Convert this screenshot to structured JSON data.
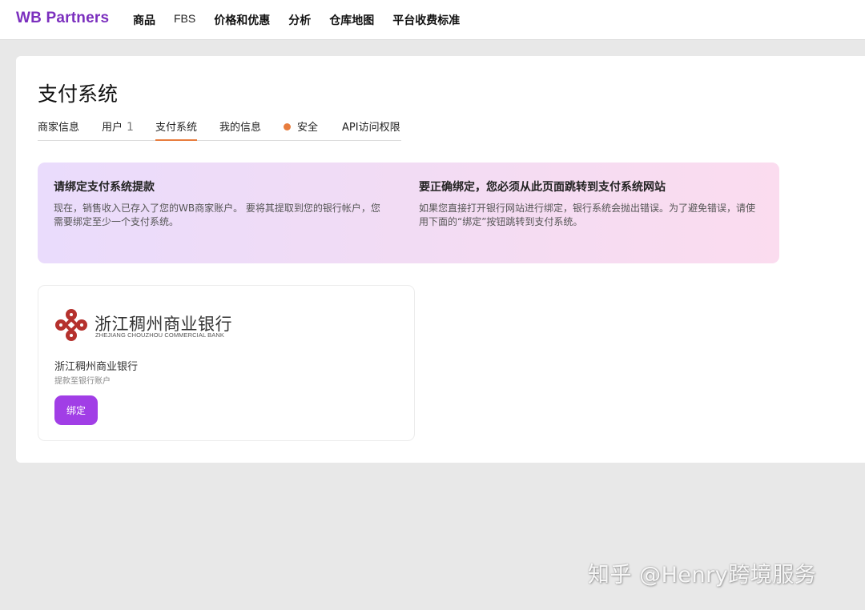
{
  "brand": "WB Partners",
  "nav": [
    "商品",
    "FBS",
    "价格和优惠",
    "分析",
    "仓库地图",
    "平台收费标准"
  ],
  "page_title": "支付系统",
  "tabs": {
    "merchant_info": "商家信息",
    "users": "用户",
    "users_count": "1",
    "payment": "支付系统",
    "my_info": "我的信息",
    "security": "安全",
    "api": "API访问权限"
  },
  "banner": {
    "left_title": "请绑定支付系统提款",
    "left_text": "现在，销售收入已存入了您的WB商家账户。 要将其提取到您的银行帐户，您需要绑定至少一个支付系统。",
    "right_title": "要正确绑定，您必须从此页面跳转到支付系统网站",
    "right_text": "如果您直接打开银行网站进行绑定，银行系统会抛出错误。为了避免错误，请使用下面的“绑定”按钮跳转到支付系统。"
  },
  "bank_card": {
    "logo_text_cn": "浙江稠州商业银行",
    "logo_text_en": "ZHEJIANG CHOUZHOU COMMERCIAL BANK",
    "name": "浙江稠州商业银行",
    "subtitle": "提款至银行账户",
    "bind_label": "绑定"
  },
  "watermark": "知乎 @Henry跨境服务",
  "colors": {
    "brand": "#7b2fbe",
    "accent_orange": "#e87d3e",
    "button": "#a13ee6",
    "logo_red": "#b5312d"
  },
  "icons": {
    "bank_logo": "chouzhou-bank-logo-icon",
    "security_dot": "orange-dot-icon"
  }
}
